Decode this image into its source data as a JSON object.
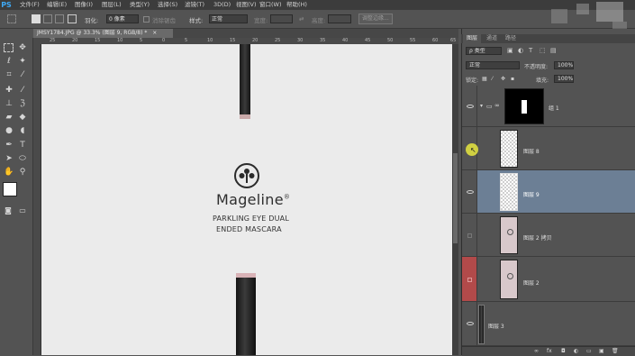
{
  "app": {
    "logo": "PS"
  },
  "menu": [
    "文件(F)",
    "编辑(E)",
    "图像(I)",
    "图层(L)",
    "类型(Y)",
    "选择(S)",
    "滤镜(T)",
    "3D(D)",
    "视图(V)",
    "窗口(W)",
    "帮助(H)"
  ],
  "options": {
    "feather_label": "羽化:",
    "feather_value": "0 像素",
    "antialias_label": "消除锯齿",
    "style_label": "样式:",
    "style_value": "正常",
    "width_label": "宽度:",
    "height_label": "高度:",
    "refine_edge_button": "调整边缘..."
  },
  "document": {
    "tab_title": "JMSY1784.JPG @ 33.3% (图层 9, RGB/8) *",
    "close": "×"
  },
  "ruler": {
    "h_ticks": [
      "25",
      "20",
      "15",
      "10",
      "5",
      "0",
      "5",
      "10",
      "15",
      "20",
      "25",
      "30",
      "35",
      "40",
      "45",
      "50",
      "55",
      "60",
      "65"
    ]
  },
  "canvas": {
    "brand": "Mageline",
    "brand_mark": "®",
    "line1": "PARKLING EYE DUAL",
    "line2": "ENDED MASCARA"
  },
  "panel": {
    "tabs": [
      "图层",
      "通道",
      "路径"
    ],
    "filter_kind": "ρ 类型",
    "blend_mode": "正常",
    "opacity_label": "不透明度:",
    "opacity_value": "100%",
    "lock_label": "锁定:",
    "fill_label": "填充:",
    "fill_value": "100%"
  },
  "layers": [
    {
      "name": "组 1",
      "visible": true,
      "selected": false,
      "type": "group"
    },
    {
      "name": "图层 8",
      "visible": true,
      "selected": false,
      "type": "layer"
    },
    {
      "name": "图层 9",
      "visible": true,
      "selected": true,
      "type": "layer"
    },
    {
      "name": "图层 2 拷贝",
      "visible": false,
      "selected": false,
      "type": "layer"
    },
    {
      "name": "图层 2",
      "visible": false,
      "selected": false,
      "type": "layer"
    },
    {
      "name": "图层 3",
      "visible": true,
      "selected": false,
      "type": "layer"
    }
  ],
  "colors": {
    "selected_layer": "#6c7f95",
    "red_marker": "#b24a4a",
    "cursor_highlight": "#e6e640",
    "ps_blue": "#3fa9f5"
  }
}
